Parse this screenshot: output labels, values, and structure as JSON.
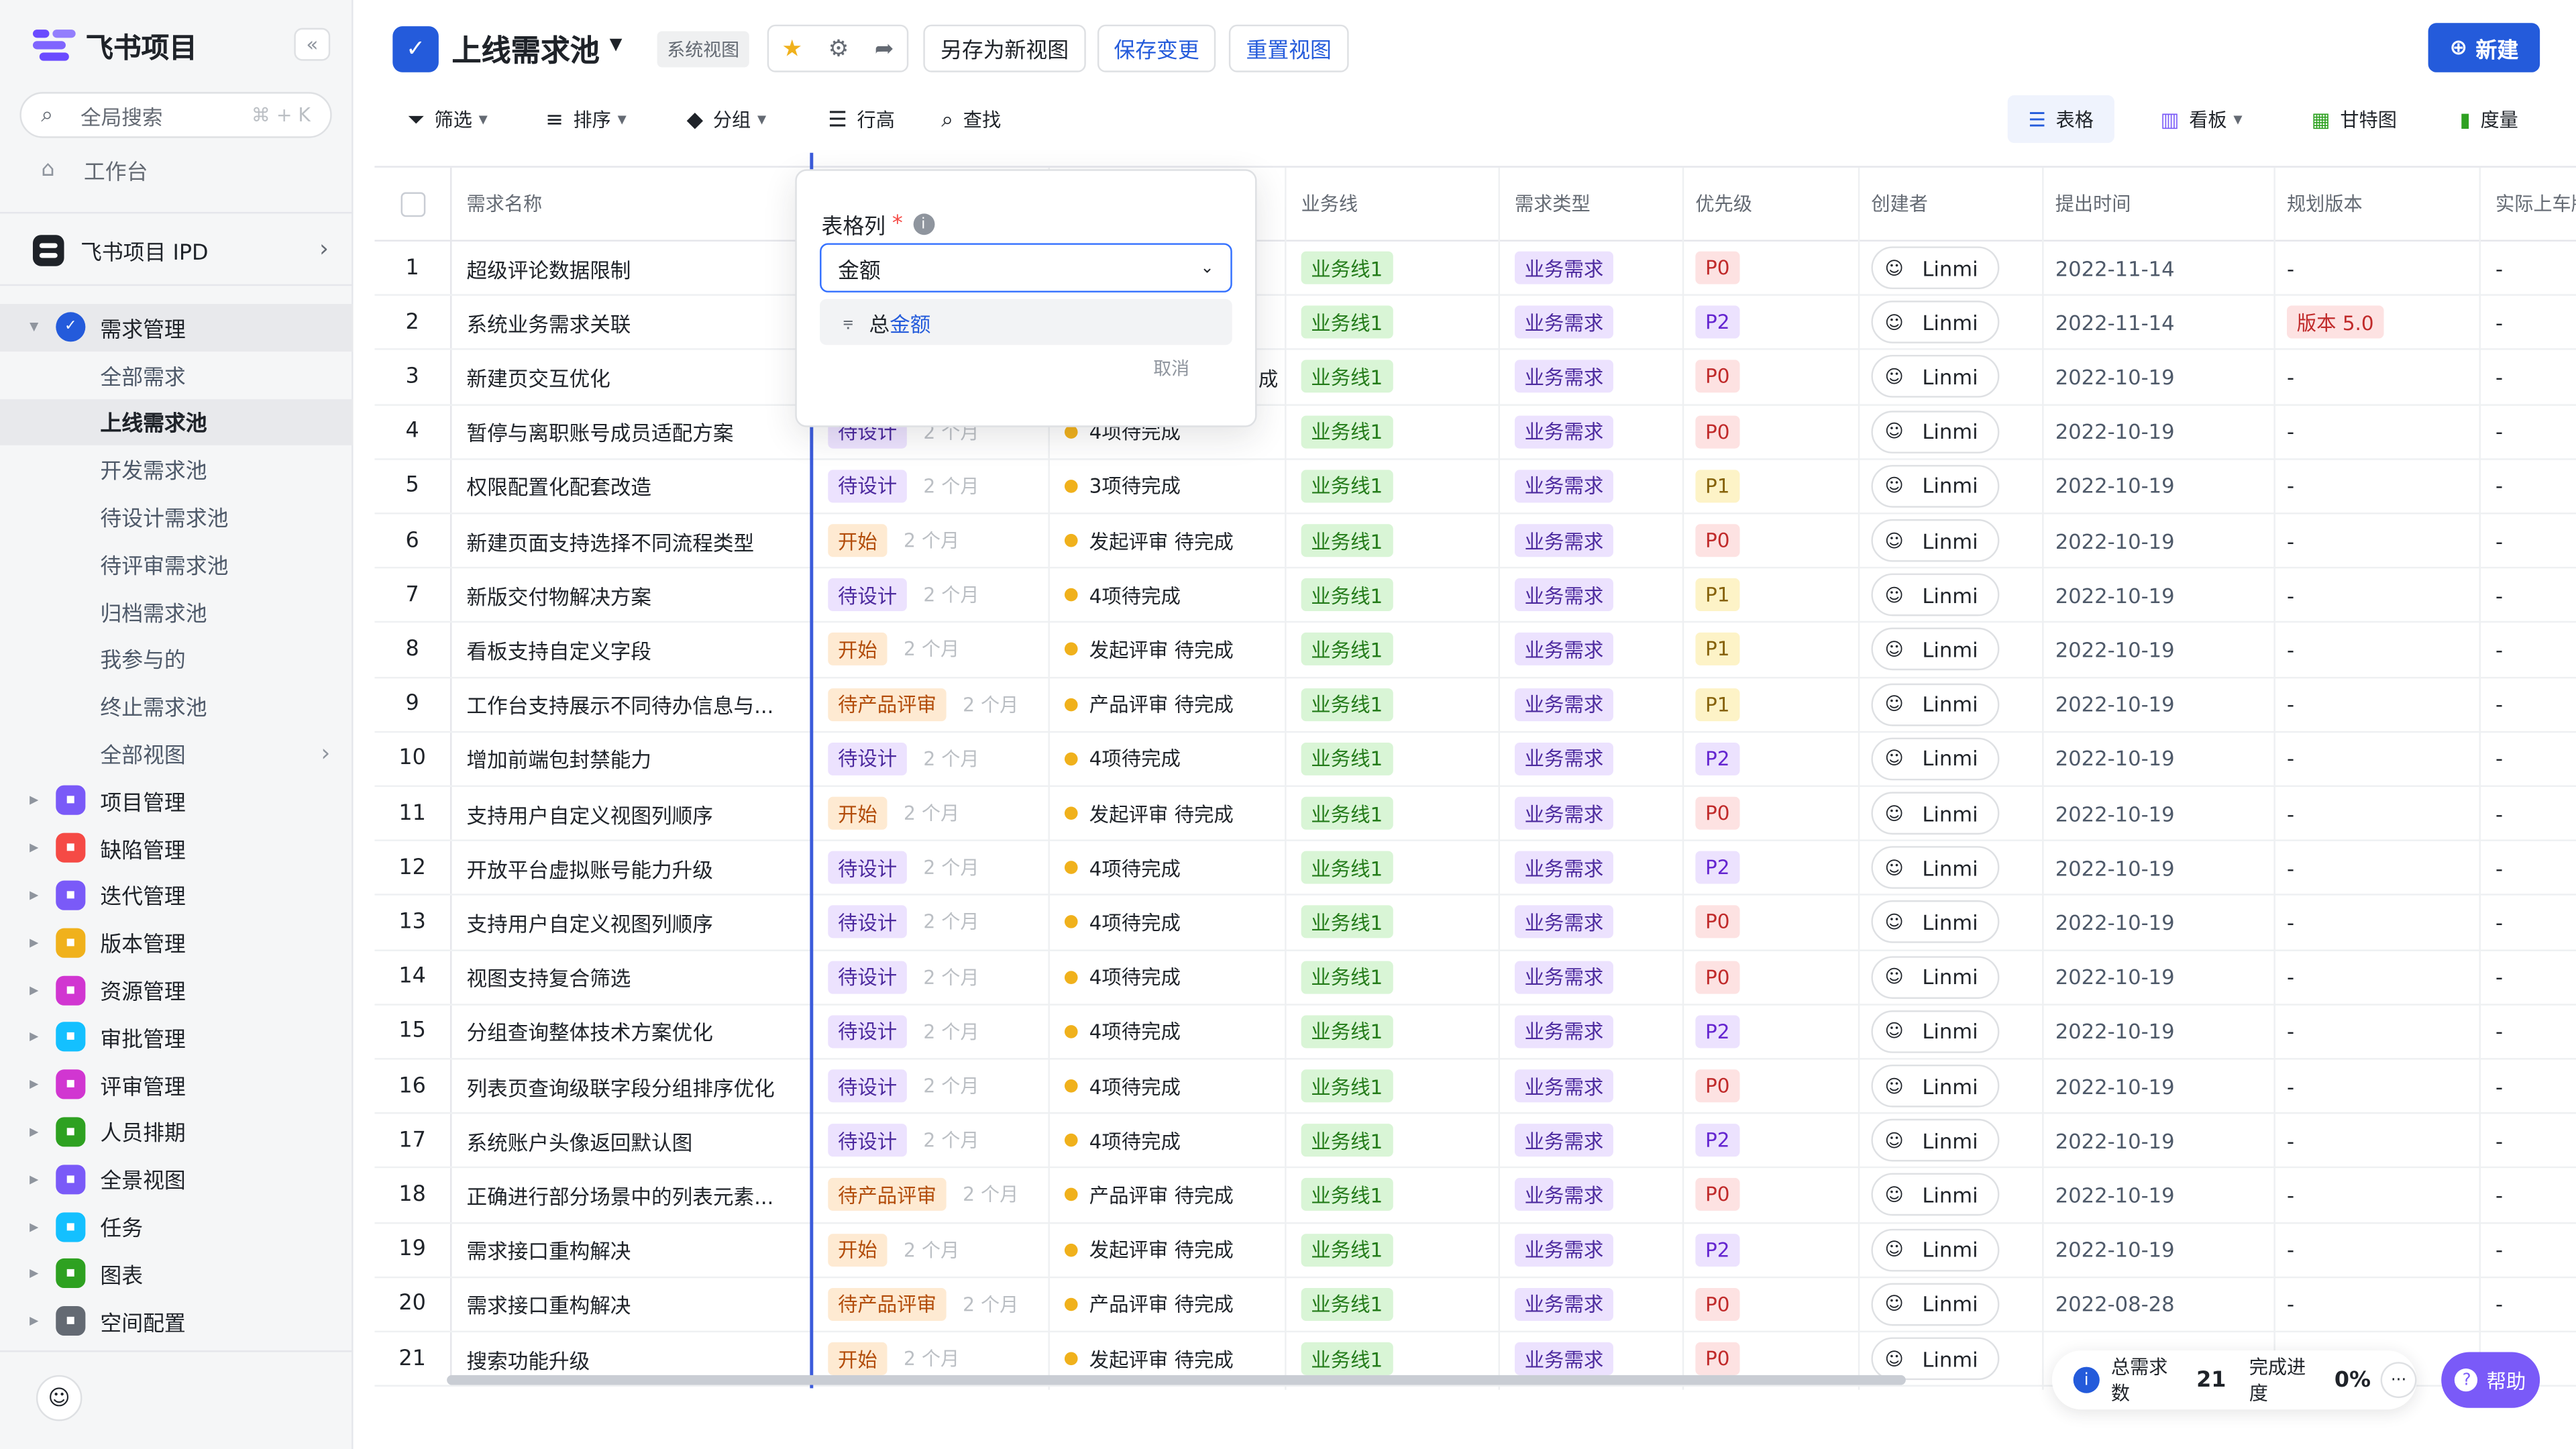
{
  "app": {
    "title": "飞书项目",
    "collapse": "«"
  },
  "search": {
    "label": "全局搜索",
    "shortcut": "⌘ + K"
  },
  "workbench": "工作台",
  "project": {
    "name": "飞书项目 IPD"
  },
  "menu": {
    "req": {
      "label": "需求管理",
      "color": "#245bdb"
    },
    "subs": [
      "全部需求",
      "上线需求池",
      "开发需求池",
      "待设计需求池",
      "待评审需求池",
      "归档需求池",
      "我参与的",
      "终止需求池",
      "全部视图"
    ],
    "others": [
      {
        "label": "项目管理",
        "color": "#7a5af8",
        "icon": "grid-icon"
      },
      {
        "label": "缺陷管理",
        "color": "#f54a45",
        "icon": "bug-icon"
      },
      {
        "label": "迭代管理",
        "color": "#7a5af8",
        "icon": "iteration-icon"
      },
      {
        "label": "版本管理",
        "color": "#f0b11c",
        "icon": "version-icon"
      },
      {
        "label": "资源管理",
        "color": "#d136d1",
        "icon": "resource-icon"
      },
      {
        "label": "审批管理",
        "color": "#14c0ff",
        "icon": "approval-icon"
      },
      {
        "label": "评审管理",
        "color": "#d136d1",
        "icon": "review-icon"
      },
      {
        "label": "人员排期",
        "color": "#2ea121",
        "icon": "schedule-icon"
      },
      {
        "label": "全景视图",
        "color": "#7a5af8",
        "icon": "panorama-icon"
      },
      {
        "label": "任务",
        "color": "#14c0ff",
        "icon": "task-icon"
      },
      {
        "label": "图表",
        "color": "#2ea121",
        "icon": "chart-icon"
      },
      {
        "label": "空间配置",
        "color": "#646a73",
        "icon": "config-icon"
      }
    ]
  },
  "header": {
    "title": "上线需求池",
    "badge": "系统视图",
    "save_as": "另存为新视图",
    "save": "保存变更",
    "reset": "重置视图",
    "new": "新建"
  },
  "toolbar": {
    "filter": "筛选",
    "sort": "排序",
    "group": "分组",
    "rowheight": "行高",
    "find": "查找",
    "table": "表格",
    "board": "看板",
    "gantt": "甘特图",
    "metric": "度量"
  },
  "columns": [
    "需求名称",
    "业务线",
    "需求类型",
    "优先级",
    "创建者",
    "提出时间",
    "规划版本",
    "实际上车版本"
  ],
  "rows": [
    {
      "no": "1",
      "name": "超级评论数据限制",
      "status": "",
      "dur": "",
      "prog": "",
      "bl": "业务线1",
      "type": "业务需求",
      "pri": "P0",
      "creator": "Linmi",
      "date": "2022-11-14",
      "plan": "-",
      "actual": "-"
    },
    {
      "no": "2",
      "name": "系统业务需求关联",
      "status": "",
      "dur": "",
      "prog": "",
      "bl": "业务线1",
      "type": "业务需求",
      "pri": "P2",
      "creator": "Linmi",
      "date": "2022-11-14",
      "plan": "版本 5.0",
      "actual": "-"
    },
    {
      "no": "3",
      "name": "新建页交互优化",
      "status": "",
      "dur": "",
      "prog": "",
      "bl": "业务线1",
      "type": "业务需求",
      "pri": "P0",
      "creator": "Linmi",
      "date": "2022-10-19",
      "plan": "-",
      "actual": "-"
    },
    {
      "no": "4",
      "name": "暂停与离职账号成员适配方案",
      "status": "待设计",
      "dur": "2 个月",
      "prog": "4项待完成",
      "bl": "业务线1",
      "type": "业务需求",
      "pri": "P0",
      "creator": "Linmi",
      "date": "2022-10-19",
      "plan": "-",
      "actual": "-"
    },
    {
      "no": "5",
      "name": "权限配置化配套改造",
      "status": "待设计",
      "dur": "2 个月",
      "prog": "3项待完成",
      "bl": "业务线1",
      "type": "业务需求",
      "pri": "P1",
      "creator": "Linmi",
      "date": "2022-10-19",
      "plan": "-",
      "actual": "-"
    },
    {
      "no": "6",
      "name": "新建页面支持选择不同流程类型",
      "status": "开始",
      "dur": "2 个月",
      "prog": "发起评审 待完成",
      "bl": "业务线1",
      "type": "业务需求",
      "pri": "P0",
      "creator": "Linmi",
      "date": "2022-10-19",
      "plan": "-",
      "actual": "-"
    },
    {
      "no": "7",
      "name": "新版交付物解决方案",
      "status": "待设计",
      "dur": "2 个月",
      "prog": "4项待完成",
      "bl": "业务线1",
      "type": "业务需求",
      "pri": "P1",
      "creator": "Linmi",
      "date": "2022-10-19",
      "plan": "-",
      "actual": "-"
    },
    {
      "no": "8",
      "name": "看板支持自定义字段",
      "status": "开始",
      "dur": "2 个月",
      "prog": "发起评审 待完成",
      "bl": "业务线1",
      "type": "业务需求",
      "pri": "P1",
      "creator": "Linmi",
      "date": "2022-10-19",
      "plan": "-",
      "actual": "-"
    },
    {
      "no": "9",
      "name": "工作台支持展示不同待办信息与...",
      "status": "待产品评审",
      "dur": "2 个月",
      "prog": "产品评审 待完成",
      "bl": "业务线1",
      "type": "业务需求",
      "pri": "P1",
      "creator": "Linmi",
      "date": "2022-10-19",
      "plan": "-",
      "actual": "-"
    },
    {
      "no": "10",
      "name": "增加前端包封禁能力",
      "status": "待设计",
      "dur": "2 个月",
      "prog": "4项待完成",
      "bl": "业务线1",
      "type": "业务需求",
      "pri": "P2",
      "creator": "Linmi",
      "date": "2022-10-19",
      "plan": "-",
      "actual": "-"
    },
    {
      "no": "11",
      "name": "支持用户自定义视图列顺序",
      "status": "开始",
      "dur": "2 个月",
      "prog": "发起评审 待完成",
      "bl": "业务线1",
      "type": "业务需求",
      "pri": "P0",
      "creator": "Linmi",
      "date": "2022-10-19",
      "plan": "-",
      "actual": "-"
    },
    {
      "no": "12",
      "name": "开放平台虚拟账号能力升级",
      "status": "待设计",
      "dur": "2 个月",
      "prog": "4项待完成",
      "bl": "业务线1",
      "type": "业务需求",
      "pri": "P2",
      "creator": "Linmi",
      "date": "2022-10-19",
      "plan": "-",
      "actual": "-"
    },
    {
      "no": "13",
      "name": "支持用户自定义视图列顺序",
      "status": "待设计",
      "dur": "2 个月",
      "prog": "4项待完成",
      "bl": "业务线1",
      "type": "业务需求",
      "pri": "P0",
      "creator": "Linmi",
      "date": "2022-10-19",
      "plan": "-",
      "actual": "-"
    },
    {
      "no": "14",
      "name": "视图支持复合筛选",
      "status": "待设计",
      "dur": "2 个月",
      "prog": "4项待完成",
      "bl": "业务线1",
      "type": "业务需求",
      "pri": "P0",
      "creator": "Linmi",
      "date": "2022-10-19",
      "plan": "-",
      "actual": "-"
    },
    {
      "no": "15",
      "name": "分组查询整体技术方案优化",
      "status": "待设计",
      "dur": "2 个月",
      "prog": "4项待完成",
      "bl": "业务线1",
      "type": "业务需求",
      "pri": "P2",
      "creator": "Linmi",
      "date": "2022-10-19",
      "plan": "-",
      "actual": "-"
    },
    {
      "no": "16",
      "name": "列表页查询级联字段分组排序优化",
      "status": "待设计",
      "dur": "2 个月",
      "prog": "4项待完成",
      "bl": "业务线1",
      "type": "业务需求",
      "pri": "P0",
      "creator": "Linmi",
      "date": "2022-10-19",
      "plan": "-",
      "actual": "-"
    },
    {
      "no": "17",
      "name": "系统账户头像返回默认图",
      "status": "待设计",
      "dur": "2 个月",
      "prog": "4项待完成",
      "bl": "业务线1",
      "type": "业务需求",
      "pri": "P2",
      "creator": "Linmi",
      "date": "2022-10-19",
      "plan": "-",
      "actual": "-"
    },
    {
      "no": "18",
      "name": "正确进行部分场景中的列表元素...",
      "status": "待产品评审",
      "dur": "2 个月",
      "prog": "产品评审 待完成",
      "bl": "业务线1",
      "type": "业务需求",
      "pri": "P0",
      "creator": "Linmi",
      "date": "2022-10-19",
      "plan": "-",
      "actual": "-"
    },
    {
      "no": "19",
      "name": "需求接口重构解决",
      "status": "开始",
      "dur": "2 个月",
      "prog": "发起评审 待完成",
      "bl": "业务线1",
      "type": "业务需求",
      "pri": "P2",
      "creator": "Linmi",
      "date": "2022-10-19",
      "plan": "-",
      "actual": "-"
    },
    {
      "no": "20",
      "name": "需求接口重构解决",
      "status": "待产品评审",
      "dur": "2 个月",
      "prog": "产品评审 待完成",
      "bl": "业务线1",
      "type": "业务需求",
      "pri": "P0",
      "creator": "Linmi",
      "date": "2022-08-28",
      "plan": "-",
      "actual": "-"
    },
    {
      "no": "21",
      "name": "搜索功能升级",
      "status": "开始",
      "dur": "2 个月",
      "prog": "发起评审 待完成",
      "bl": "业务线1",
      "type": "业务需求",
      "pri": "P0",
      "creator": "Linmi",
      "date": "",
      "plan": "",
      "actual": "-"
    }
  ],
  "popup": {
    "label": "表格列",
    "required": "*",
    "value": "金额",
    "option_prefix": "总",
    "option_highlight": "金额",
    "cancel": "取消",
    "row3_prog_fragment": "成"
  },
  "stats": {
    "total_label": "总需求数",
    "total": "21",
    "progress_label": "完成进度",
    "progress": "0%",
    "more": "···"
  },
  "help": "帮助"
}
